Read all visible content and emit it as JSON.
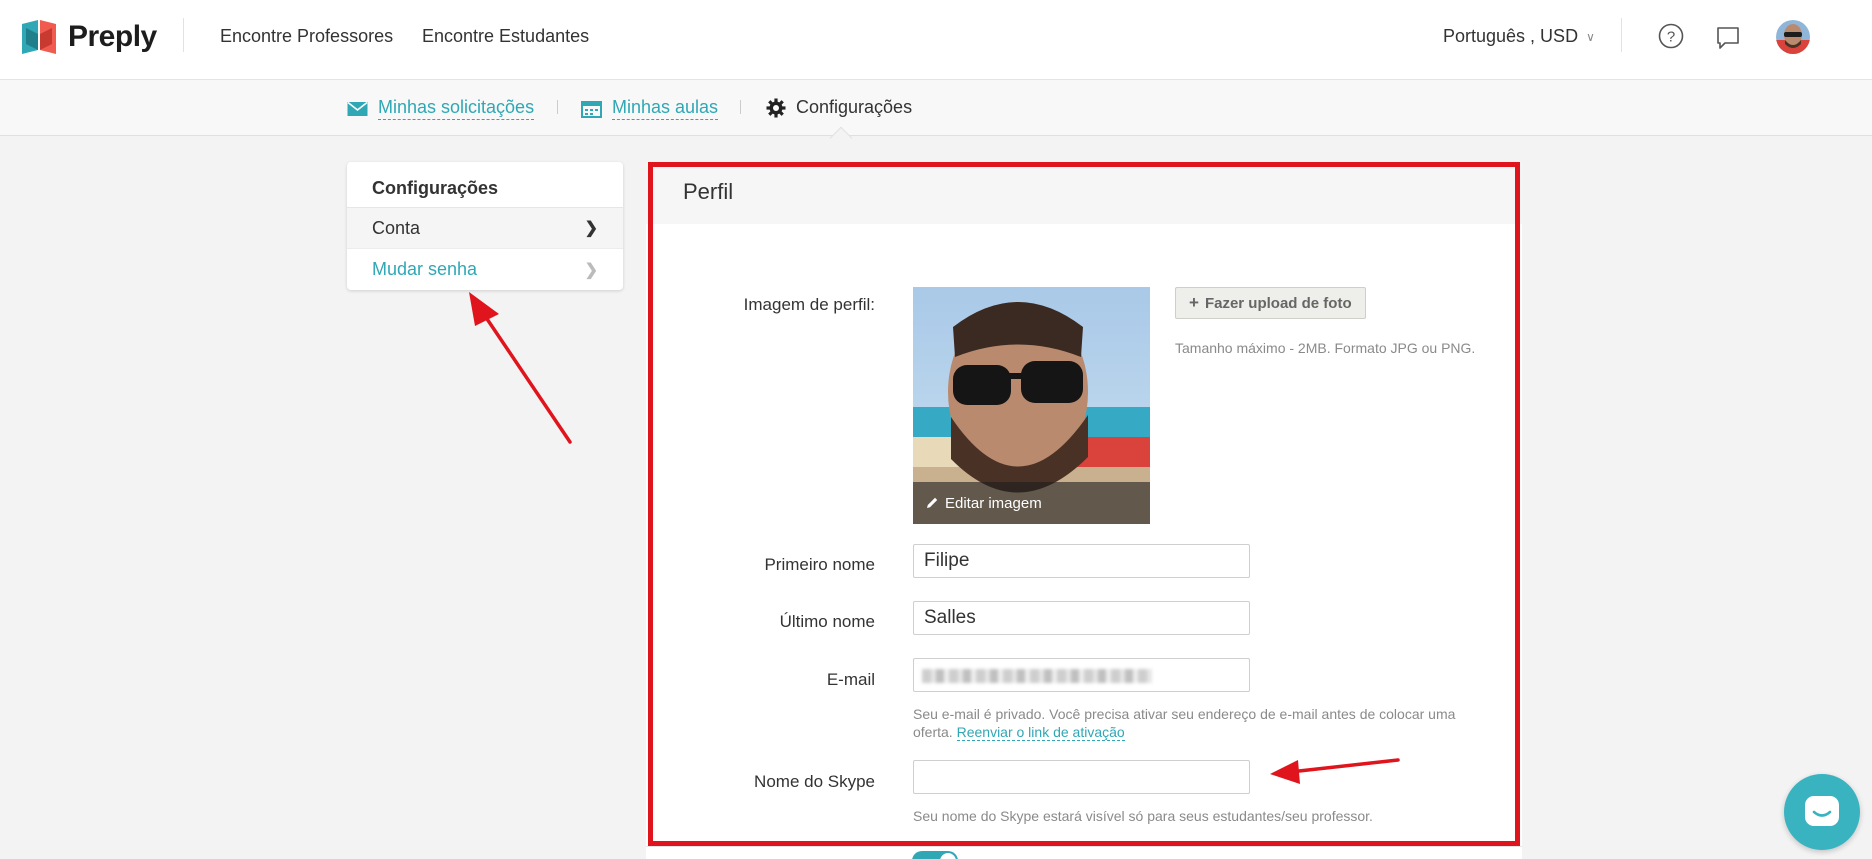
{
  "brand": {
    "name": "Preply"
  },
  "topnav": {
    "find_teachers": "Encontre Professores",
    "find_students": "Encontre Estudantes",
    "language_currency": "Português , USD"
  },
  "subnav": {
    "requests": "Minhas solicitações",
    "lessons": "Minhas aulas",
    "settings": "Configurações"
  },
  "sidebar": {
    "title": "Configurações",
    "items": [
      {
        "label": "Conta"
      },
      {
        "label": "Mudar senha"
      }
    ]
  },
  "profile": {
    "title": "Perfil",
    "image_label": "Imagem de perfil:",
    "edit_image": "Editar imagem",
    "upload_button": "Fazer upload de foto",
    "upload_hint": "Tamanho máximo - 2MB. Formato JPG ou PNG.",
    "first_name_label": "Primeiro nome",
    "first_name_value": "Filipe",
    "last_name_label": "Último nome",
    "last_name_value": "Salles",
    "email_label": "E-mail",
    "email_hint": "Seu e-mail é privado. Você precisa ativar seu endereço de e-mail antes de colocar uma oferta.",
    "email_resend_link": "Reenviar o link de ativação",
    "skype_label": "Nome do Skype",
    "skype_value": "",
    "skype_hint": "Seu nome do Skype estará visível só para seus estudantes/seu professor."
  },
  "colors": {
    "accent": "#2fa7b5",
    "annotation_red": "#e0141c"
  },
  "icons": [
    "envelope-icon",
    "calendar-icon",
    "gear-icon",
    "help-icon",
    "chat-icon",
    "chevron-right-icon",
    "pencil-icon",
    "plus-icon",
    "messenger-icon"
  ]
}
